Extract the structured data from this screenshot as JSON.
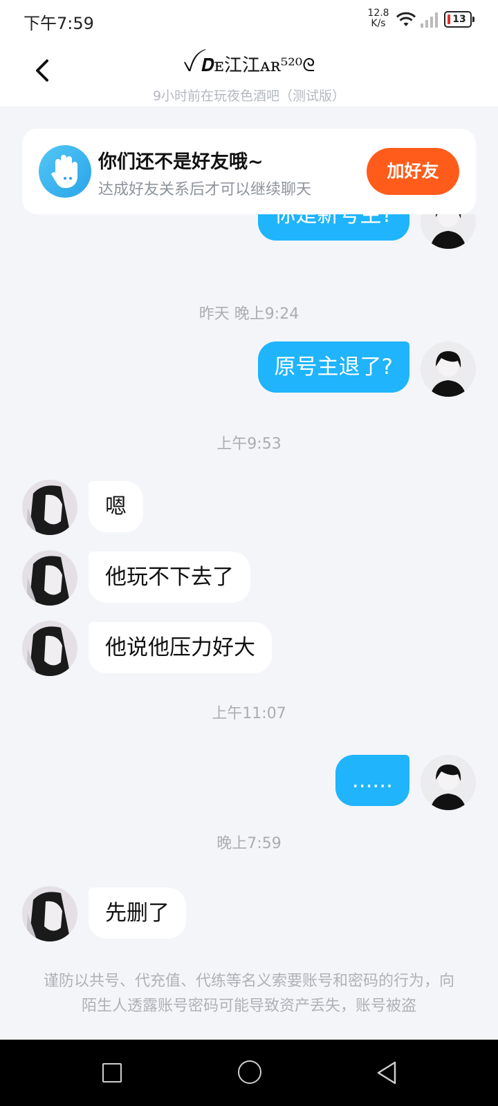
{
  "status_bar": {
    "time": "下午7:59",
    "net_speed_value": "12.8",
    "net_speed_unit": "K/s",
    "battery": "13"
  },
  "header": {
    "title": "ꪜ 𝑫ᴇ江江ᴀʀ⁵²⁰ᘓ",
    "subtitle": "9小时前在玩夜色酒吧（测试版）"
  },
  "banner": {
    "title": "你们还不是好友哦~",
    "subtitle": "达成好友关系后才可以继续聊天",
    "button": "加好友"
  },
  "messages": {
    "partial_me": "你是新号主?",
    "time_1": "昨天 晚上9:24",
    "me_1": "原号主退了?",
    "time_2": "上午9:53",
    "them_1": "嗯",
    "them_2": "他玩不下去了",
    "them_3": "他说他压力好大",
    "time_3": "上午11:07",
    "me_2": "......",
    "time_4": "晚上7:59",
    "them_4": "先删了"
  },
  "warning": "谨防以共号、代充值、代练等名义索要账号和密码的行为，向陌生人透露账号密码可能导致资产丢失，账号被盗",
  "colors": {
    "my_bubble": "#1fb4fb",
    "add_button": "#ff5c1b",
    "background": "#f3f5f8"
  }
}
